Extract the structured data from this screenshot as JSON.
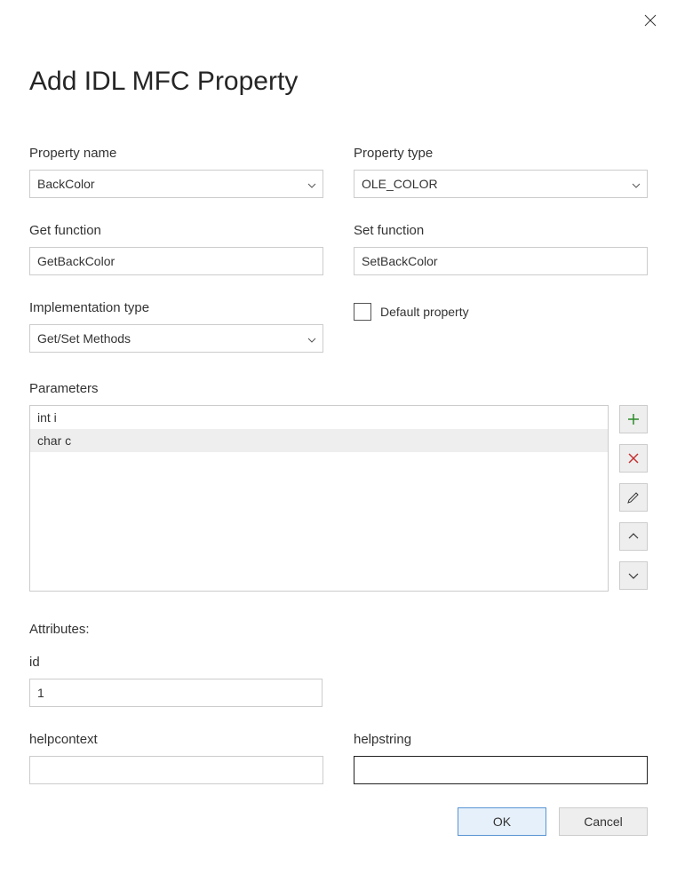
{
  "title": "Add IDL MFC Property",
  "labels": {
    "property_name": "Property name",
    "property_type": "Property type",
    "get_function": "Get function",
    "set_function": "Set function",
    "implementation_type": "Implementation type",
    "default_property": "Default property",
    "parameters": "Parameters",
    "attributes": "Attributes:",
    "id": "id",
    "helpcontext": "helpcontext",
    "helpstring": "helpstring"
  },
  "values": {
    "property_name": "BackColor",
    "property_type": "OLE_COLOR",
    "get_function": "GetBackColor",
    "set_function": "SetBackColor",
    "implementation_type": "Get/Set Methods",
    "id": "1",
    "helpcontext": "",
    "helpstring": ""
  },
  "parameters": [
    {
      "text": "int i",
      "selected": false
    },
    {
      "text": "char c",
      "selected": true
    }
  ],
  "buttons": {
    "ok": "OK",
    "cancel": "Cancel"
  }
}
